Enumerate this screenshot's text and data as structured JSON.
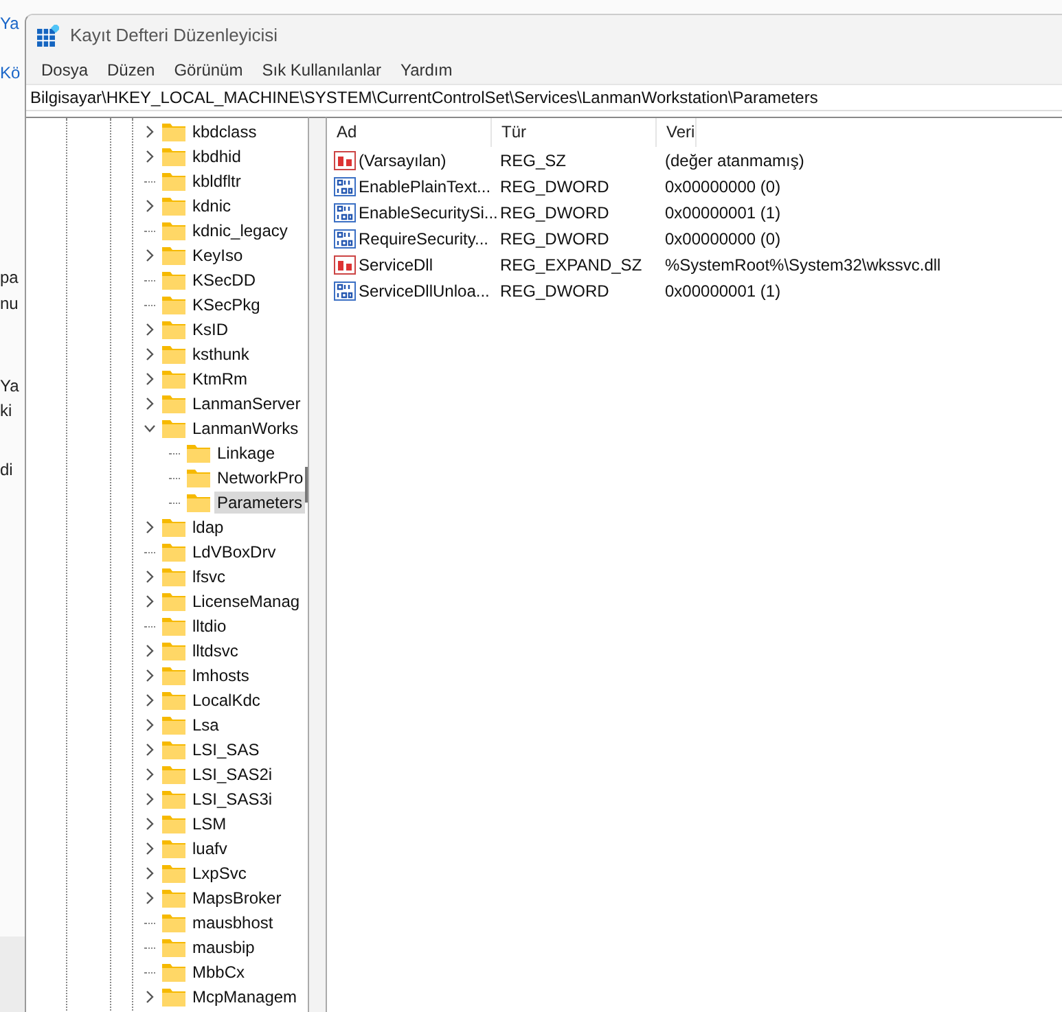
{
  "background_page": {
    "texts": [
      {
        "text": "Ya",
        "kind": "link"
      },
      {
        "text": "Kö",
        "kind": "link"
      },
      {
        "text": "pa",
        "kind": "plain"
      },
      {
        "text": "nu",
        "kind": "plain"
      },
      {
        "text": "Ya",
        "kind": "plain"
      },
      {
        "text": "ki",
        "kind": "plain"
      },
      {
        "text": "di",
        "kind": "plain"
      }
    ]
  },
  "window": {
    "title": "Kayıt Defteri Düzenleyicisi"
  },
  "menu": [
    "Dosya",
    "Düzen",
    "Görünüm",
    "Sık Kullanılanlar",
    "Yardım"
  ],
  "address_bar": {
    "value": "Bilgisayar\\HKEY_LOCAL_MACHINE\\SYSTEM\\CurrentControlSet\\Services\\LanmanWorkstation\\Parameters"
  },
  "tree": {
    "items": [
      {
        "label": "kbdclass",
        "expanded": false,
        "selected": false
      },
      {
        "label": "kbdhid",
        "expanded": false,
        "selected": false
      },
      {
        "label": "kbldfltr",
        "selected": false
      },
      {
        "label": "kdnic",
        "expanded": false,
        "selected": false
      },
      {
        "label": "kdnic_legacy",
        "selected": false
      },
      {
        "label": "KeyIso",
        "expanded": false,
        "selected": false
      },
      {
        "label": "KSecDD",
        "selected": false
      },
      {
        "label": "KSecPkg",
        "selected": false
      },
      {
        "label": "KsID",
        "expanded": false,
        "selected": false
      },
      {
        "label": "ksthunk",
        "expanded": false,
        "selected": false
      },
      {
        "label": "KtmRm",
        "expanded": false,
        "selected": false
      },
      {
        "label": "LanmanServer",
        "expanded": false,
        "selected": false
      },
      {
        "label": "LanmanWorks",
        "expanded": true,
        "selected": false,
        "children": [
          {
            "label": "Linkage",
            "selected": false
          },
          {
            "label": "NetworkPro",
            "selected": false
          },
          {
            "label": "Parameters",
            "selected": true
          }
        ]
      },
      {
        "label": "ldap",
        "expanded": false,
        "selected": false
      },
      {
        "label": "LdVBoxDrv",
        "selected": false
      },
      {
        "label": "lfsvc",
        "expanded": false,
        "selected": false
      },
      {
        "label": "LicenseManag",
        "expanded": false,
        "selected": false
      },
      {
        "label": "lltdio",
        "selected": false
      },
      {
        "label": "lltdsvc",
        "expanded": false,
        "selected": false
      },
      {
        "label": "lmhosts",
        "expanded": false,
        "selected": false
      },
      {
        "label": "LocalKdc",
        "expanded": false,
        "selected": false
      },
      {
        "label": "Lsa",
        "expanded": false,
        "selected": false
      },
      {
        "label": "LSI_SAS",
        "expanded": false,
        "selected": false
      },
      {
        "label": "LSI_SAS2i",
        "expanded": false,
        "selected": false
      },
      {
        "label": "LSI_SAS3i",
        "expanded": false,
        "selected": false
      },
      {
        "label": "LSM",
        "expanded": false,
        "selected": false
      },
      {
        "label": "luafv",
        "expanded": false,
        "selected": false
      },
      {
        "label": "LxpSvc",
        "expanded": false,
        "selected": false
      },
      {
        "label": "MapsBroker",
        "expanded": false,
        "selected": false
      },
      {
        "label": "mausbhost",
        "selected": false
      },
      {
        "label": "mausbip",
        "selected": false
      },
      {
        "label": "MbbCx",
        "selected": false
      },
      {
        "label": "McpManagem",
        "expanded": false,
        "selected": false
      }
    ]
  },
  "values": {
    "columns": [
      "Ad",
      "Tür",
      "Veri"
    ],
    "rows": [
      {
        "kind": "string",
        "name": "(Varsayılan)",
        "type": "REG_SZ",
        "data": "(değer atanmamış)"
      },
      {
        "kind": "binary",
        "name": "EnablePlainText...",
        "type": "REG_DWORD",
        "data": "0x00000000 (0)"
      },
      {
        "kind": "binary",
        "name": "EnableSecuritySi...",
        "type": "REG_DWORD",
        "data": "0x00000001 (1)"
      },
      {
        "kind": "binary",
        "name": "RequireSecurity...",
        "type": "REG_DWORD",
        "data": "0x00000000 (0)"
      },
      {
        "kind": "string",
        "name": "ServiceDll",
        "type": "REG_EXPAND_SZ",
        "data": "%SystemRoot%\\System32\\wkssvc.dll"
      },
      {
        "kind": "binary",
        "name": "ServiceDllUnloa...",
        "type": "REG_DWORD",
        "data": "0x00000001 (1)"
      }
    ]
  }
}
